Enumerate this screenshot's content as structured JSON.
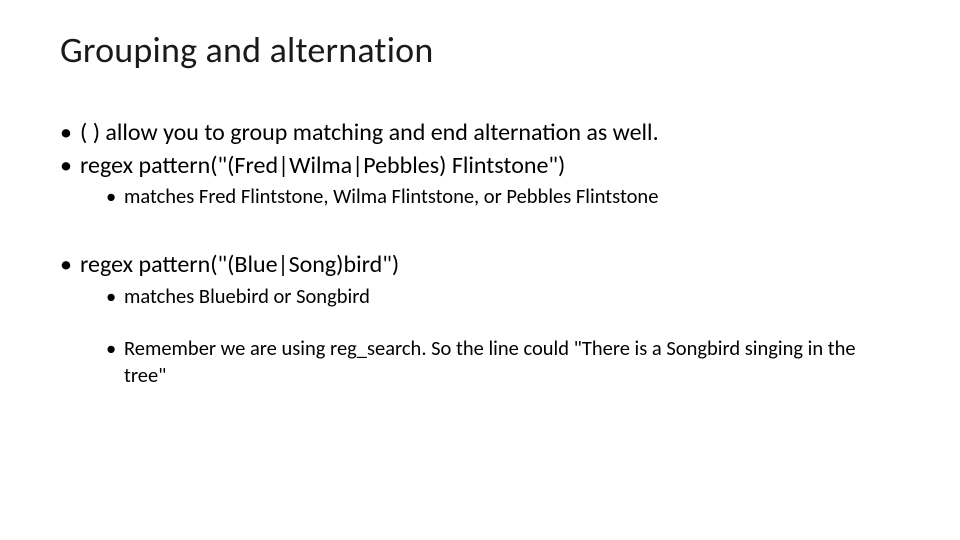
{
  "slide": {
    "title": "Grouping and alternation",
    "bullets": {
      "b1": "( )  allow you to group matching and end alternation as well.",
      "b2": "regex pattern(\"(Fred|Wilma|Pebbles) Flintstone\")",
      "b2_sub1": "matches Fred Flintstone, Wilma Flintstone, or Pebbles Flintstone",
      "b3": "regex pattern(\"(Blue|Song)bird\")",
      "b3_sub1": "matches Bluebird or Songbird",
      "b3_sub2": "Remember we are using reg_search.   So the line could \"There is a Songbird singing in the tree\""
    }
  }
}
